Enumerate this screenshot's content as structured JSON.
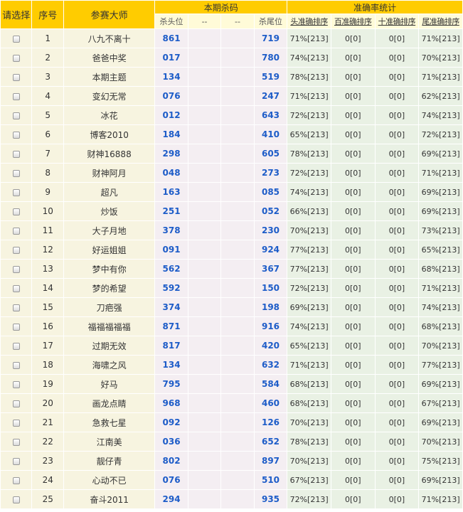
{
  "headers": {
    "select": "请选择",
    "index": "序号",
    "master": "参赛大师",
    "kill_group": "本期杀码",
    "kill_head": "杀头位",
    "blank1": "--",
    "blank2": "--",
    "kill_tail": "杀尾位",
    "accuracy_group": "准确率统计",
    "head_rank": "头准确排序",
    "hundred_rank": "百准确排序",
    "ten_rank": "十准确排序",
    "tail_rank": "尾准确排序"
  },
  "rows": [
    {
      "idx": "1",
      "name": "八九不离十",
      "head": "861",
      "tail": "719",
      "s1": "71%[213]",
      "s2": "0[0]",
      "s3": "0[0]",
      "s4": "71%[213]"
    },
    {
      "idx": "2",
      "name": "爸爸中奖",
      "head": "017",
      "tail": "780",
      "s1": "74%[213]",
      "s2": "0[0]",
      "s3": "0[0]",
      "s4": "70%[213]"
    },
    {
      "idx": "3",
      "name": "本期主题",
      "head": "134",
      "tail": "519",
      "s1": "78%[213]",
      "s2": "0[0]",
      "s3": "0[0]",
      "s4": "71%[213]"
    },
    {
      "idx": "4",
      "name": "变幻无常",
      "head": "076",
      "tail": "247",
      "s1": "71%[213]",
      "s2": "0[0]",
      "s3": "0[0]",
      "s4": "62%[213]"
    },
    {
      "idx": "5",
      "name": "冰花",
      "head": "012",
      "tail": "643",
      "s1": "72%[213]",
      "s2": "0[0]",
      "s3": "0[0]",
      "s4": "74%[213]"
    },
    {
      "idx": "6",
      "name": "博客2010",
      "head": "184",
      "tail": "410",
      "s1": "65%[213]",
      "s2": "0[0]",
      "s3": "0[0]",
      "s4": "72%[213]"
    },
    {
      "idx": "7",
      "name": "财神16888",
      "head": "298",
      "tail": "605",
      "s1": "78%[213]",
      "s2": "0[0]",
      "s3": "0[0]",
      "s4": "69%[213]"
    },
    {
      "idx": "8",
      "name": "财神阿月",
      "head": "048",
      "tail": "273",
      "s1": "72%[213]",
      "s2": "0[0]",
      "s3": "0[0]",
      "s4": "71%[213]"
    },
    {
      "idx": "9",
      "name": "超凡",
      "head": "163",
      "tail": "085",
      "s1": "74%[213]",
      "s2": "0[0]",
      "s3": "0[0]",
      "s4": "69%[213]"
    },
    {
      "idx": "10",
      "name": "炒饭",
      "head": "251",
      "tail": "052",
      "s1": "66%[213]",
      "s2": "0[0]",
      "s3": "0[0]",
      "s4": "69%[213]"
    },
    {
      "idx": "11",
      "name": "大子月地",
      "head": "378",
      "tail": "230",
      "s1": "70%[213]",
      "s2": "0[0]",
      "s3": "0[0]",
      "s4": "73%[213]"
    },
    {
      "idx": "12",
      "name": "好运姐姐",
      "head": "091",
      "tail": "924",
      "s1": "77%[213]",
      "s2": "0[0]",
      "s3": "0[0]",
      "s4": "65%[213]"
    },
    {
      "idx": "13",
      "name": "梦中有你",
      "head": "562",
      "tail": "367",
      "s1": "77%[213]",
      "s2": "0[0]",
      "s3": "0[0]",
      "s4": "68%[213]"
    },
    {
      "idx": "14",
      "name": "梦的希望",
      "head": "592",
      "tail": "150",
      "s1": "72%[213]",
      "s2": "0[0]",
      "s3": "0[0]",
      "s4": "71%[213]"
    },
    {
      "idx": "15",
      "name": "刀疤强",
      "head": "374",
      "tail": "198",
      "s1": "69%[213]",
      "s2": "0[0]",
      "s3": "0[0]",
      "s4": "74%[213]"
    },
    {
      "idx": "16",
      "name": "福福福福福",
      "head": "871",
      "tail": "916",
      "s1": "74%[213]",
      "s2": "0[0]",
      "s3": "0[0]",
      "s4": "68%[213]"
    },
    {
      "idx": "17",
      "name": "过期无效",
      "head": "817",
      "tail": "420",
      "s1": "65%[213]",
      "s2": "0[0]",
      "s3": "0[0]",
      "s4": "70%[213]"
    },
    {
      "idx": "18",
      "name": "海啸之风",
      "head": "134",
      "tail": "632",
      "s1": "71%[213]",
      "s2": "0[0]",
      "s3": "0[0]",
      "s4": "77%[213]"
    },
    {
      "idx": "19",
      "name": "好马",
      "head": "795",
      "tail": "584",
      "s1": "68%[213]",
      "s2": "0[0]",
      "s3": "0[0]",
      "s4": "69%[213]"
    },
    {
      "idx": "20",
      "name": "画龙点睛",
      "head": "968",
      "tail": "460",
      "s1": "68%[213]",
      "s2": "0[0]",
      "s3": "0[0]",
      "s4": "67%[213]"
    },
    {
      "idx": "21",
      "name": "急救七星",
      "head": "092",
      "tail": "126",
      "s1": "70%[213]",
      "s2": "0[0]",
      "s3": "0[0]",
      "s4": "69%[213]"
    },
    {
      "idx": "22",
      "name": "江南美",
      "head": "036",
      "tail": "652",
      "s1": "78%[213]",
      "s2": "0[0]",
      "s3": "0[0]",
      "s4": "70%[213]"
    },
    {
      "idx": "23",
      "name": "靓仔青",
      "head": "802",
      "tail": "897",
      "s1": "70%[213]",
      "s2": "0[0]",
      "s3": "0[0]",
      "s4": "75%[213]"
    },
    {
      "idx": "24",
      "name": "心动不已",
      "head": "076",
      "tail": "510",
      "s1": "67%[213]",
      "s2": "0[0]",
      "s3": "0[0]",
      "s4": "69%[213]"
    },
    {
      "idx": "25",
      "name": "奋斗2011",
      "head": "294",
      "tail": "935",
      "s1": "72%[213]",
      "s2": "0[0]",
      "s3": "0[0]",
      "s4": "71%[213]"
    }
  ],
  "colors": {
    "header_yellow": "#ffcc00",
    "number_blue": "#1d5cc8",
    "stat_green": "#e9f1e4",
    "kill_pink": "#f4eef2"
  }
}
